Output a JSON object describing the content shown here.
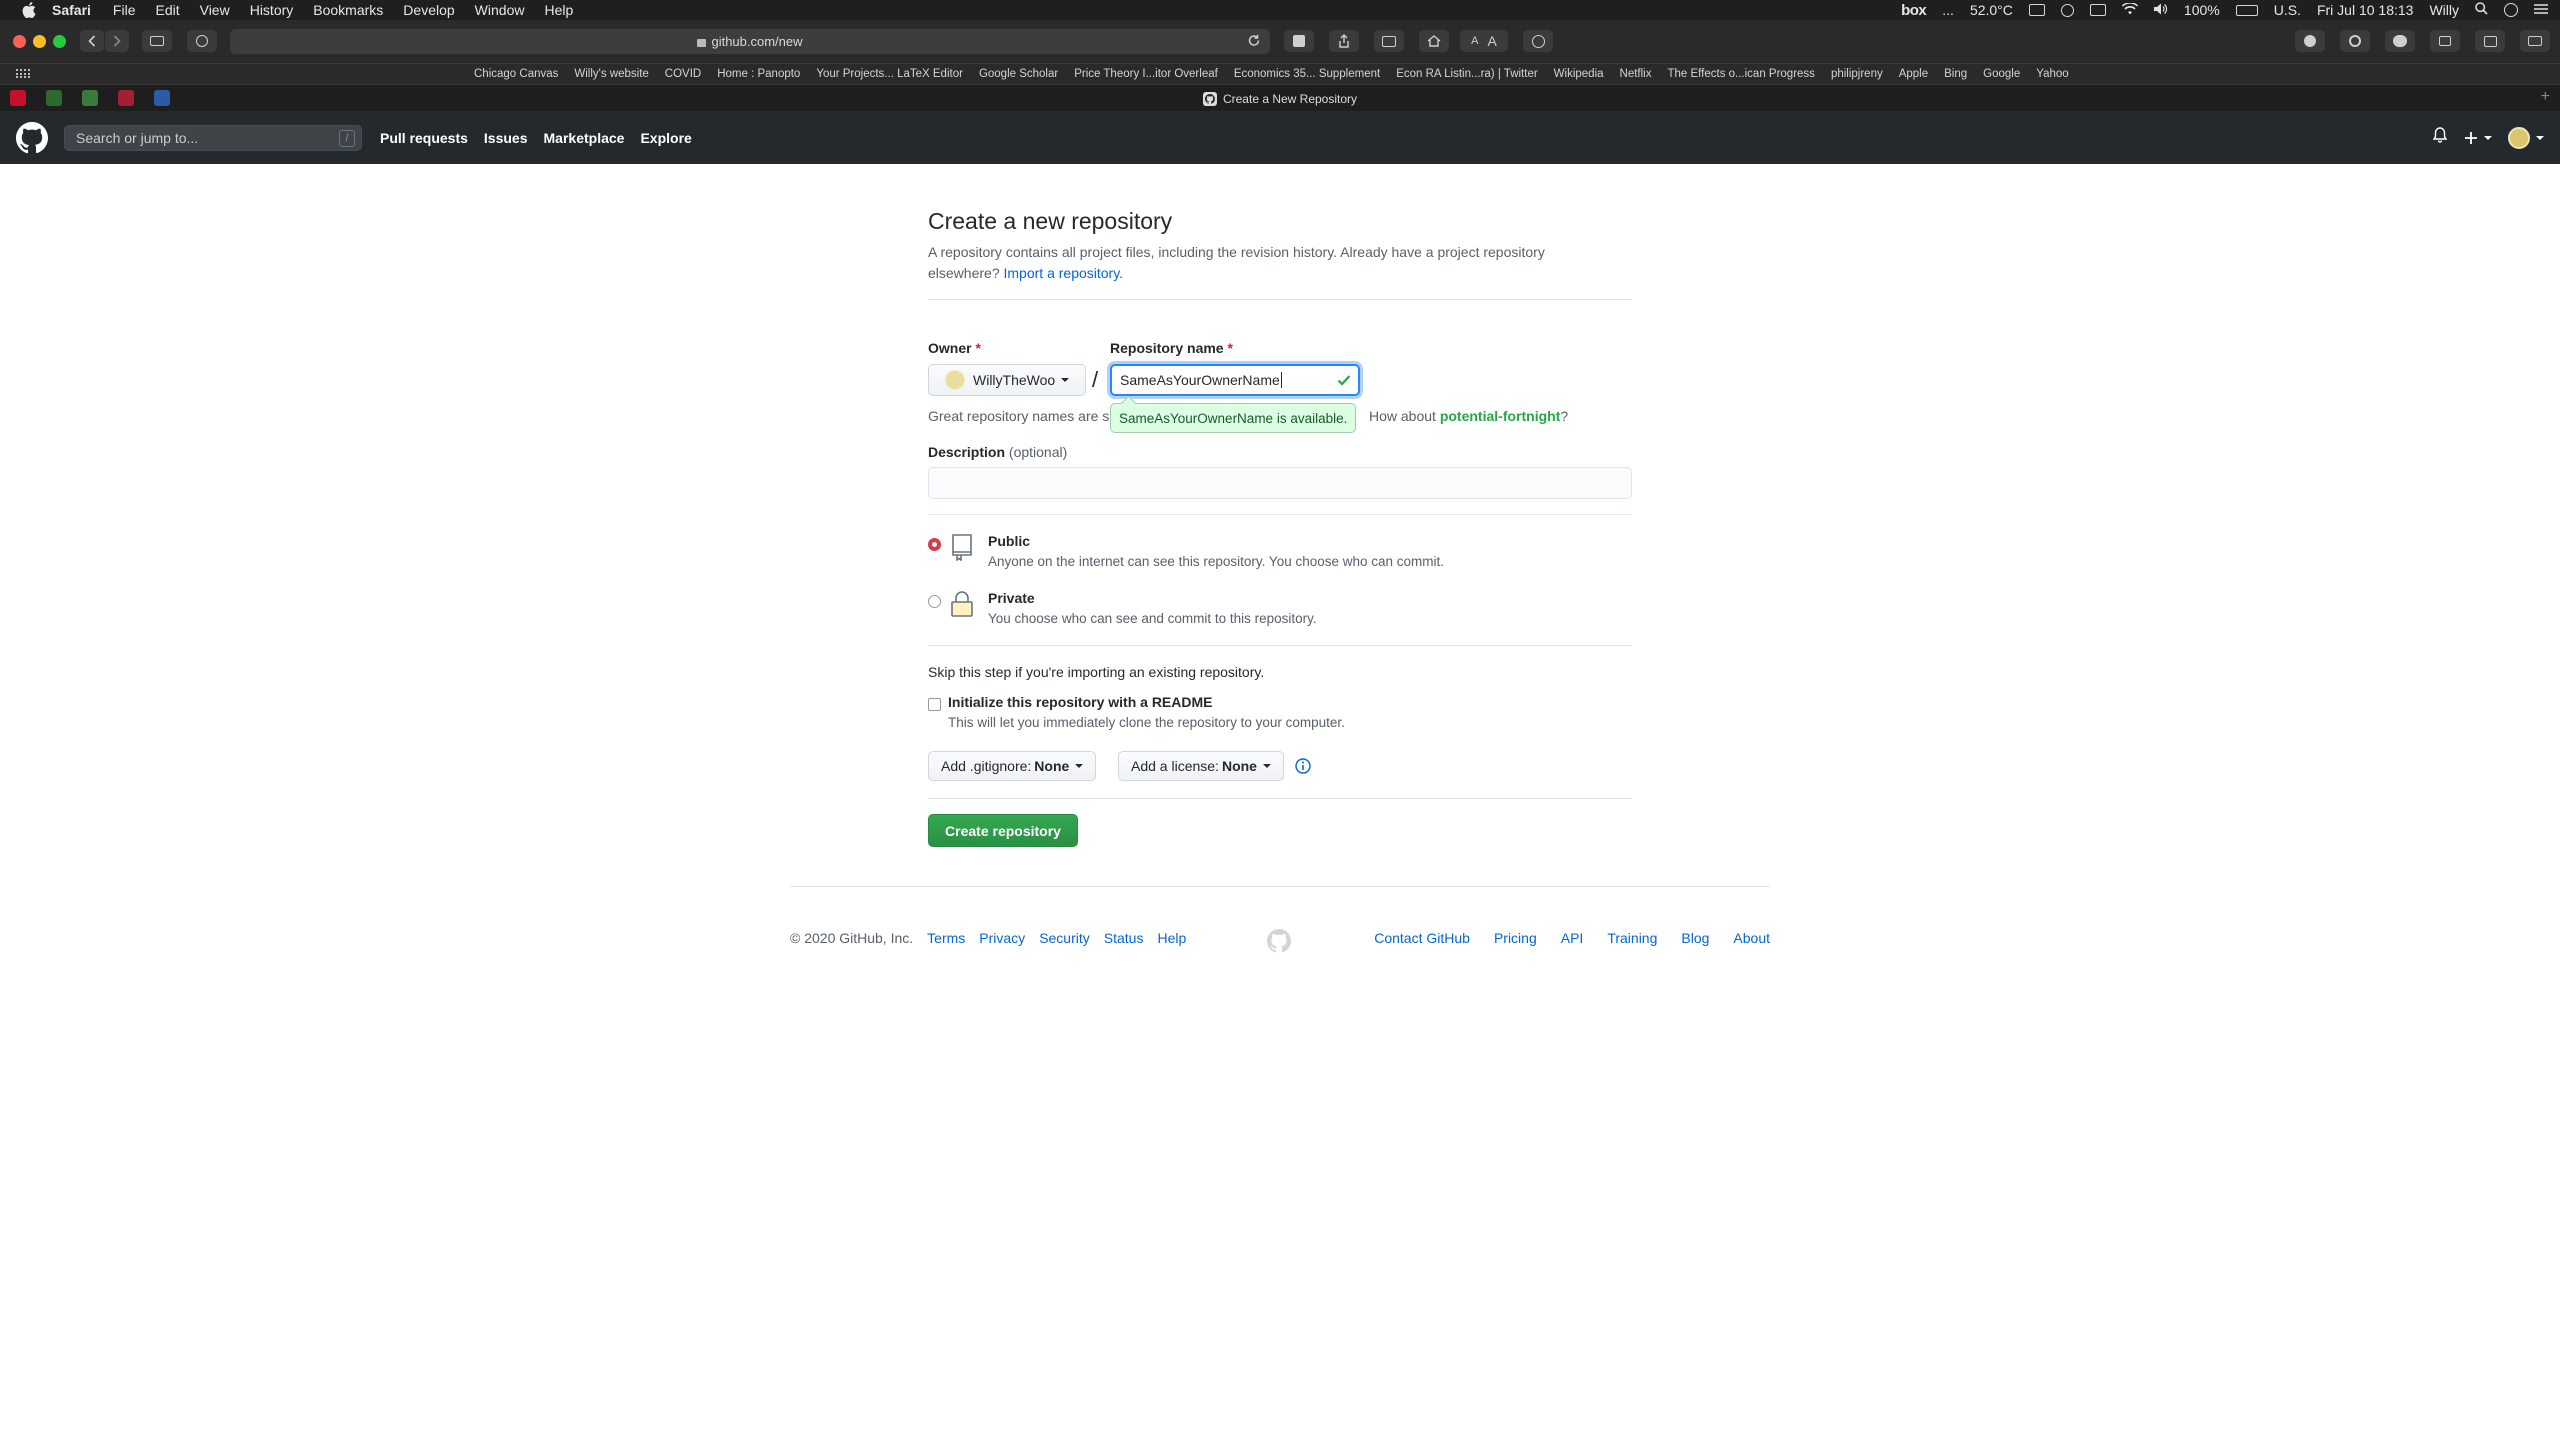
{
  "menubar": {
    "app": "Safari",
    "items": [
      "File",
      "Edit",
      "View",
      "History",
      "Bookmarks",
      "Develop",
      "Window",
      "Help"
    ],
    "status": {
      "box": "box",
      "ellipsis": "...",
      "temperature": "52.0°C",
      "battery": "100%",
      "input_source": "U.S.",
      "clock": "Fri Jul 10  18:13",
      "user": "Willy"
    }
  },
  "browser": {
    "url": "github.com/new",
    "favorites": [
      "Chicago Canvas",
      "Willy's website",
      "COVID",
      "Home : Panopto",
      "Your Projects... LaTeX Editor",
      "Google Scholar",
      "Price Theory I...itor Overleaf",
      "Economics 35... Supplement",
      "Econ RA Listin...ra) | Twitter",
      "Wikipedia",
      "Netflix",
      "The Effects o...ican Progress",
      "philipjreny",
      "Apple",
      "Bing",
      "Google",
      "Yahoo"
    ],
    "tab_title": "Create a New Repository",
    "reader_labels": [
      "A",
      "A"
    ]
  },
  "header": {
    "search_placeholder": "Search or jump to...",
    "search_shortcut": "/",
    "nav": [
      "Pull requests",
      "Issues",
      "Marketplace",
      "Explore"
    ]
  },
  "form": {
    "title": "Create a new repository",
    "subtitle": "A repository contains all project files, including the revision history. Already have a project repository elsewhere?",
    "import_link": "Import a repository.",
    "owner_label": "Owner",
    "owner_value": "WillyTheWoo",
    "separator": "/",
    "repo_label": "Repository name",
    "required_mark": "*",
    "repo_value": "SameAsYourOwnerName",
    "hint_prefix": "Great repository names are",
    "hint_frag": "s",
    "hint_suffix": "How about",
    "suggestion": "potential-fortnight",
    "suggestion_end": "?",
    "availability": "SameAsYourOwnerName is available.",
    "description_label": "Description",
    "description_optional": "(optional)",
    "description_value": "",
    "public_title": "Public",
    "public_desc": "Anyone on the internet can see this repository. You choose who can commit.",
    "private_title": "Private",
    "private_desc": "You choose who can see and commit to this repository.",
    "skip_text": "Skip this step if you're importing an existing repository.",
    "readme_label": "Initialize this repository with a README",
    "readme_desc": "This will let you immediately clone the repository to your computer.",
    "gitignore_label": "Add .gitignore:",
    "gitignore_value": "None",
    "license_label": "Add a license:",
    "license_value": "None",
    "create_button": "Create repository"
  },
  "footer": {
    "copyright": "© 2020 GitHub, Inc.",
    "left_links": [
      "Terms",
      "Privacy",
      "Security",
      "Status",
      "Help"
    ],
    "right_links": [
      "Contact GitHub",
      "Pricing",
      "API",
      "Training",
      "Blog",
      "About"
    ]
  },
  "colors": {
    "header_bg": "#24292e",
    "link": "#0366d6",
    "success": "#28a745",
    "create_button": "#2ea44f",
    "radio_selected": "#d73a49"
  },
  "icons": [
    "apple-icon",
    "github-logo-icon",
    "bell-icon",
    "plus-icon",
    "avatar",
    "check-icon",
    "repo-icon",
    "lock-icon",
    "info-icon",
    "github-mark-icon"
  ]
}
